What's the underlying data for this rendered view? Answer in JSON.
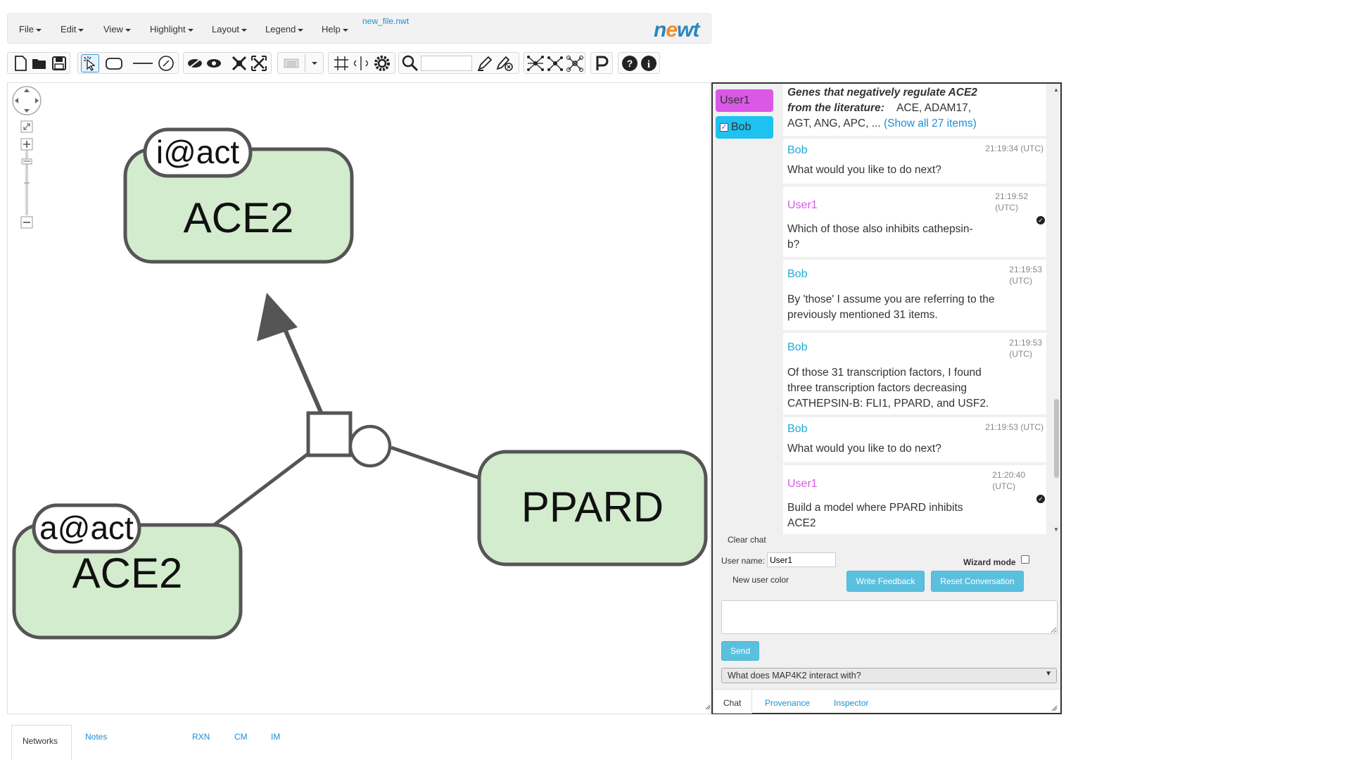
{
  "menu": {
    "items": [
      "File",
      "Edit",
      "View",
      "Highlight",
      "Layout",
      "Legend",
      "Help"
    ],
    "filename": "new_file.nwt",
    "logo": "newt"
  },
  "graph": {
    "nodes": [
      {
        "label": "ACE2",
        "state": "i@act"
      },
      {
        "label": "ACE2",
        "state": "a@act"
      },
      {
        "label": "PPARD",
        "state": ""
      }
    ]
  },
  "chat": {
    "users": [
      {
        "name": "User1",
        "color": "#d958e6",
        "checked": false
      },
      {
        "name": "Bob",
        "color": "#1ec2f0",
        "checked": true
      }
    ],
    "top_message": {
      "title_line1": "Genes that negatively regulate ACE2",
      "title_line2": "from the literature:",
      "items": "ACE, ADAM17,",
      "items2": "AGT, ANG, APC, ...",
      "link": "(Show all 27 items)"
    },
    "messages": [
      {
        "sender": "Bob",
        "time": "21:19:34 (UTC)",
        "text": "What would you like to do next?"
      },
      {
        "sender": "User1",
        "time_l1": "21:19:52",
        "time_l2": "(UTC)",
        "text_l1": "Which of those also inhibits cathepsin-",
        "text_l2": "b?"
      },
      {
        "sender": "Bob",
        "time_l1": "21:19:53",
        "time_l2": "(UTC)",
        "text_l1": "By 'those' I assume you are referring to the",
        "text_l2": "previously mentioned 31 items."
      },
      {
        "sender": "Bob",
        "time_l1": "21:19:53",
        "time_l2": "(UTC)",
        "text_l1": "Of those 31 transcription factors, I found",
        "text_l2": "three transcription factors decreasing",
        "text_l3": "CATHEPSIN-B: FLI1, PPARD, and USF2."
      },
      {
        "sender": "Bob",
        "time": "21:19:53 (UTC)",
        "text": "What would you like to do next?"
      },
      {
        "sender": "User1",
        "time_l1": "21:20:40",
        "time_l2": "(UTC)",
        "text_l1": "Build a model where PPARD inhibits",
        "text_l2": "ACE2"
      }
    ],
    "clear_chat": "Clear chat",
    "user_name_label": "User name:",
    "user_name_value": "User1",
    "wizard_mode": "Wizard mode",
    "new_user_color": "New user color",
    "write_feedback": "Write Feedback",
    "reset_conversation": "Reset Conversation",
    "send": "Send",
    "suggestion": "What does MAP4K2 interact with?",
    "tabs": [
      "Chat",
      "Provenance",
      "Inspector"
    ]
  },
  "bottom_tabs": [
    "Networks",
    "Notes",
    "RXN",
    "CM",
    "IM"
  ]
}
